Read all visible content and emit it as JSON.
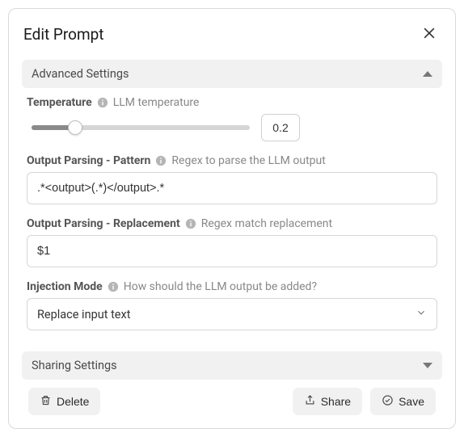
{
  "header": {
    "title": "Edit Prompt"
  },
  "advanced": {
    "section_label": "Advanced Settings",
    "temperature": {
      "label": "Temperature",
      "help": "LLM temperature",
      "value": "0.2"
    },
    "pattern": {
      "label": "Output Parsing - Pattern",
      "help": "Regex to parse the LLM output",
      "value": ".*<output>(.*)</output>.*"
    },
    "replacement": {
      "label": "Output Parsing - Replacement",
      "help": "Regex match replacement",
      "value": "$1"
    },
    "injection": {
      "label": "Injection Mode",
      "help": "How should the LLM output be added?",
      "value": "Replace input text"
    }
  },
  "sharing": {
    "section_label": "Sharing Settings"
  },
  "footer": {
    "delete": "Delete",
    "share": "Share",
    "save": "Save"
  }
}
